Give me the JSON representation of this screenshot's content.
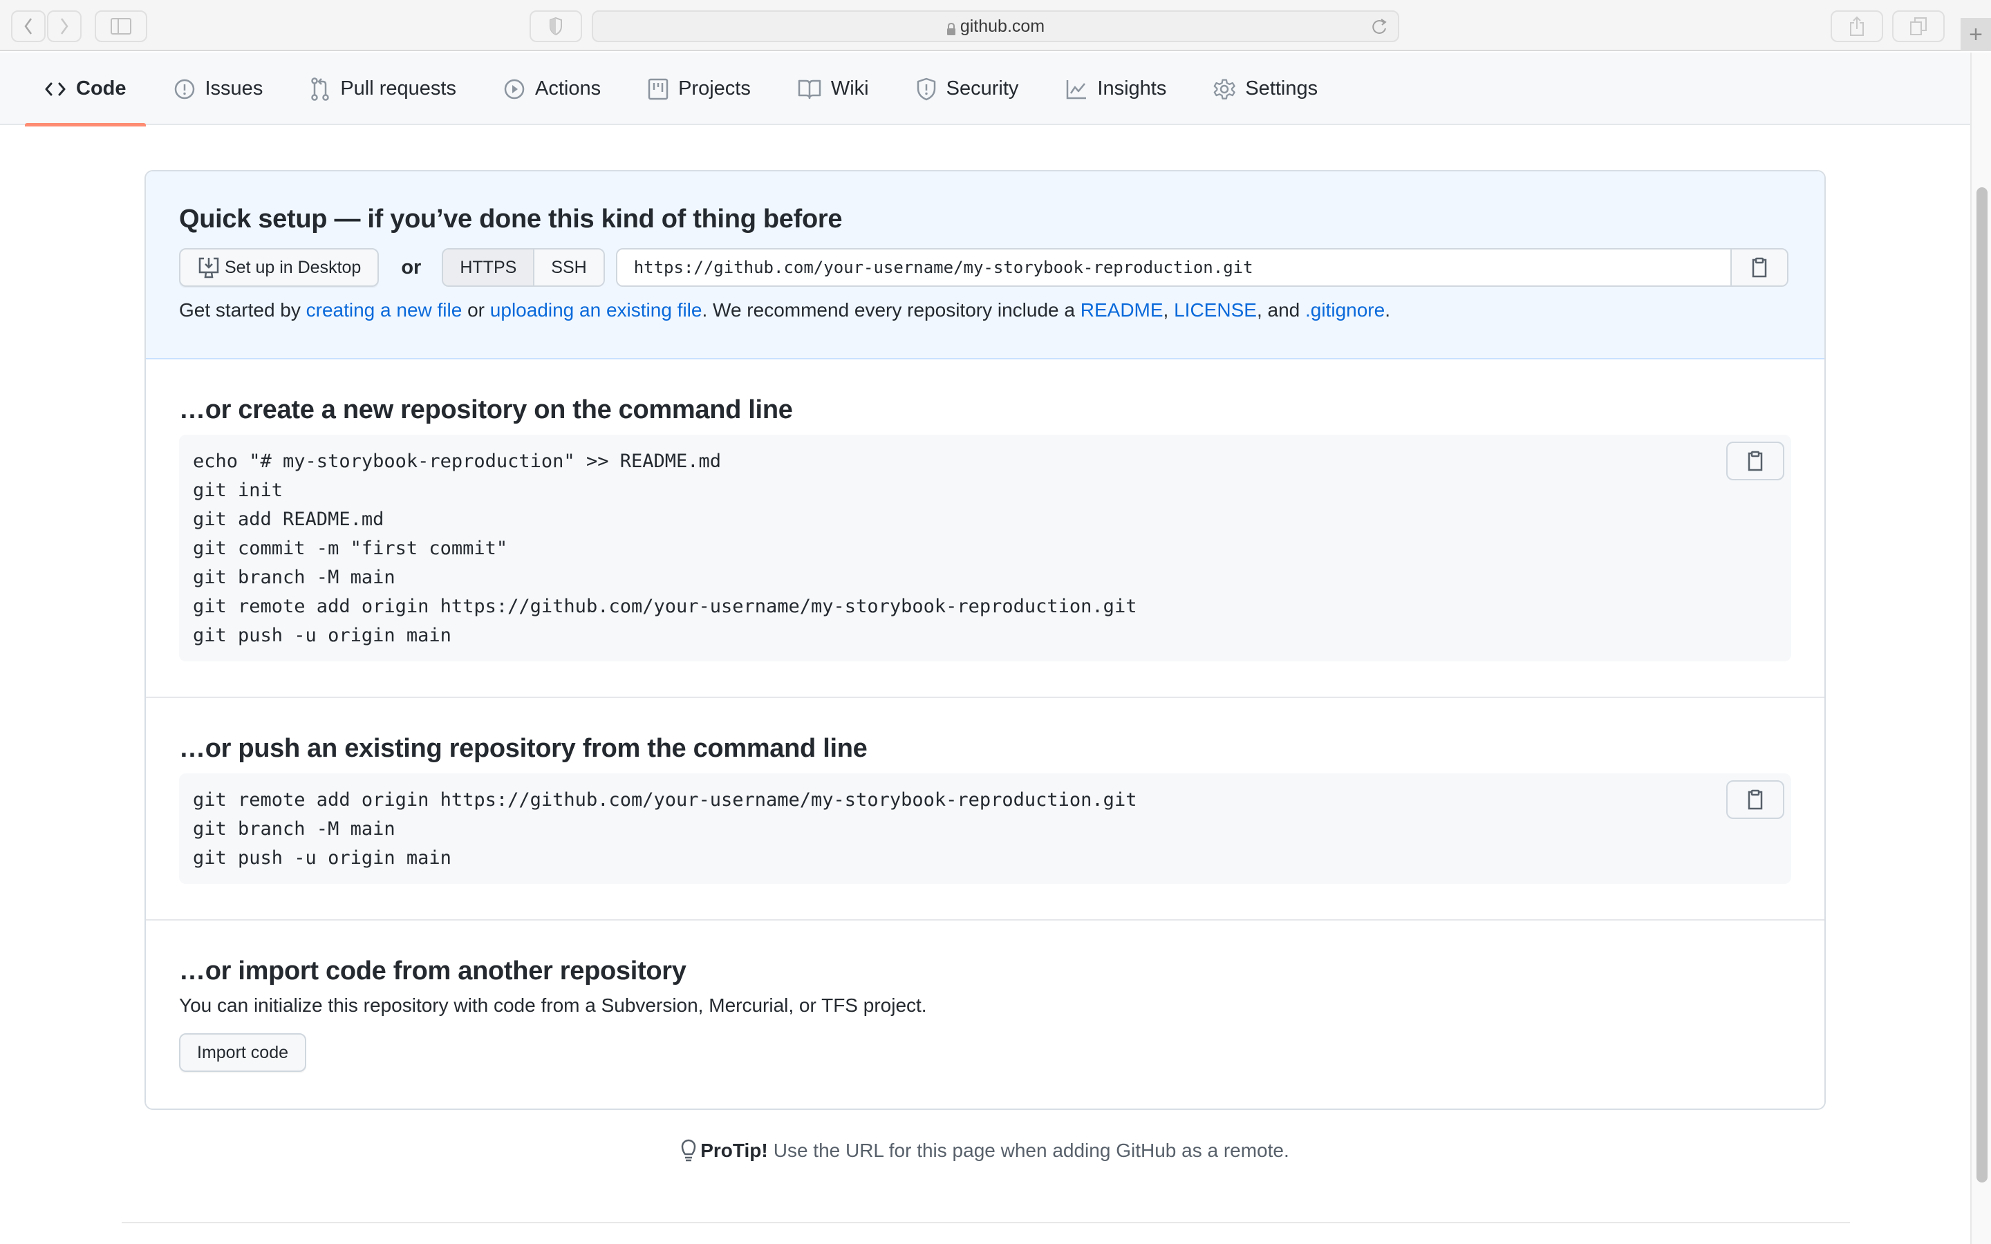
{
  "browser": {
    "url": "github.com",
    "back_icon": "chevron-left-icon",
    "forward_icon": "chevron-right-icon",
    "sidebar_icon": "sidebar-icon",
    "shield_icon": "privacy-shield-icon",
    "reload_icon": "reload-icon",
    "share_icon": "share-icon",
    "tabs_icon": "tabs-overview-icon",
    "new_tab_label": "+"
  },
  "nav": {
    "tabs": [
      {
        "label": "Code",
        "icon": "code-icon",
        "selected": true
      },
      {
        "label": "Issues",
        "icon": "issue-icon"
      },
      {
        "label": "Pull requests",
        "icon": "pull-request-icon"
      },
      {
        "label": "Actions",
        "icon": "play-icon"
      },
      {
        "label": "Projects",
        "icon": "project-icon"
      },
      {
        "label": "Wiki",
        "icon": "book-icon"
      },
      {
        "label": "Security",
        "icon": "shield-icon"
      },
      {
        "label": "Insights",
        "icon": "graph-icon"
      },
      {
        "label": "Settings",
        "icon": "gear-icon"
      }
    ]
  },
  "quick_setup": {
    "title": "Quick setup — if you’ve done this kind of thing before",
    "desktop_button": "Set up in Desktop",
    "or": "or",
    "protocols": [
      "HTTPS",
      "SSH"
    ],
    "selected_protocol": "HTTPS",
    "clone_url": "https://github.com/your-username/my-storybook-reproduction.git",
    "hint": {
      "prefix": "Get started by ",
      "link1": "creating a new file",
      "mid1": " or ",
      "link2": "uploading an existing file",
      "mid2": ". We recommend every repository include a ",
      "link3": "README",
      "sep1": ", ",
      "link4": "LICENSE",
      "sep2": ", and ",
      "link5": ".gitignore",
      "suffix": "."
    }
  },
  "create_section": {
    "title": "…or create a new repository on the command line",
    "code": "echo \"# my-storybook-reproduction\" >> README.md\ngit init\ngit add README.md\ngit commit -m \"first commit\"\ngit branch -M main\ngit remote add origin https://github.com/your-username/my-storybook-reproduction.git\ngit push -u origin main"
  },
  "push_section": {
    "title": "…or push an existing repository from the command line",
    "code": "git remote add origin https://github.com/your-username/my-storybook-reproduction.git\ngit branch -M main\ngit push -u origin main"
  },
  "import_section": {
    "title": "…or import code from another repository",
    "description": "You can initialize this repository with code from a Subversion, Mercurial, or TFS project.",
    "button": "Import code"
  },
  "protip": {
    "label": "ProTip!",
    "text": "Use the URL for this page when adding GitHub as a remote."
  },
  "colors": {
    "link": "#0969da",
    "selected_tab_underline": "#fd8c73",
    "quick_setup_bg": "#f0f7ff"
  }
}
